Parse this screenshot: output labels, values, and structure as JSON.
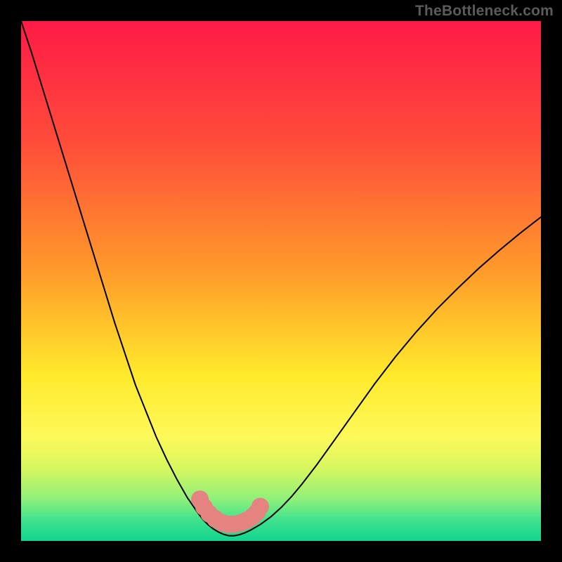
{
  "watermark": "TheBottleneck.com",
  "chart_data": {
    "type": "line",
    "title": "",
    "xlabel": "",
    "ylabel": "",
    "xlim": [
      0,
      100
    ],
    "ylim": [
      0,
      100
    ],
    "gradient_stops": [
      {
        "offset": 0.0,
        "color": "#ff1a47"
      },
      {
        "offset": 0.23,
        "color": "#ff4b3a"
      },
      {
        "offset": 0.48,
        "color": "#ff9a2a"
      },
      {
        "offset": 0.68,
        "color": "#ffe92b"
      },
      {
        "offset": 0.8,
        "color": "#fdf95a"
      },
      {
        "offset": 0.86,
        "color": "#d7f75f"
      },
      {
        "offset": 0.92,
        "color": "#8ef07a"
      },
      {
        "offset": 0.96,
        "color": "#3fe28e"
      },
      {
        "offset": 1.0,
        "color": "#11d58f"
      }
    ],
    "curve": {
      "x": [
        0,
        2,
        4,
        6,
        8,
        10,
        12,
        14,
        16,
        18,
        20,
        22,
        24,
        26,
        28,
        30,
        32,
        34,
        35,
        36,
        37,
        38,
        39,
        40,
        41,
        42,
        43,
        44,
        46,
        48,
        50,
        52,
        54,
        57,
        60,
        64,
        68,
        72,
        76,
        80,
        84,
        88,
        92,
        96,
        100
      ],
      "y": [
        100,
        94,
        87.5,
        81,
        74.5,
        68,
        61.5,
        55,
        48.5,
        42,
        36,
        30,
        25,
        20,
        15.7,
        11.8,
        8.3,
        5.4,
        4.1,
        3.1,
        2.3,
        1.7,
        1.25,
        1.0,
        1.0,
        1.2,
        1.55,
        2.0,
        3.15,
        4.6,
        6.4,
        8.5,
        10.9,
        14.8,
        19.0,
        24.6,
        30.2,
        35.4,
        40.2,
        44.6,
        48.6,
        52.4,
        55.9,
        59.2,
        62.3
      ]
    },
    "marker_band": {
      "color": "#e37a78",
      "fill": "#e58380",
      "path": {
        "x": [
          34.4,
          35.2,
          36.2,
          37.4,
          38.6,
          39.8,
          41.0,
          42.2,
          43.4,
          44.5,
          45.4,
          46.0
        ],
        "y": [
          8.0,
          6.5,
          5.2,
          4.2,
          3.5,
          3.2,
          3.2,
          3.45,
          3.95,
          4.65,
          5.55,
          6.6
        ]
      },
      "dots": {
        "x": [
          34.4,
          35.2,
          36.2,
          37.4,
          38.6,
          39.8,
          41.0,
          42.2,
          43.4,
          44.5,
          45.4,
          46.0
        ],
        "y": [
          8.0,
          6.5,
          5.2,
          4.2,
          3.5,
          3.2,
          3.2,
          3.45,
          3.95,
          4.65,
          5.55,
          6.6
        ]
      },
      "radius": 1.7
    }
  }
}
